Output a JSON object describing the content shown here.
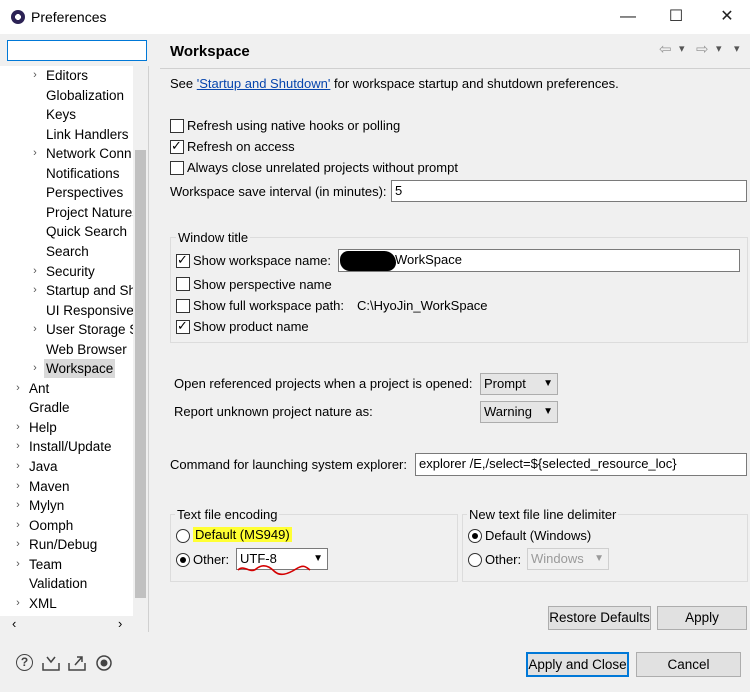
{
  "window": {
    "title": "Preferences"
  },
  "titlebar": {
    "minimize": "—",
    "maximize": "☐",
    "close": "✕"
  },
  "tree": {
    "items": [
      {
        "label": "Editors",
        "level": 2,
        "arrow": "›"
      },
      {
        "label": "Globalization",
        "level": 2,
        "arrow": ""
      },
      {
        "label": "Keys",
        "level": 2,
        "arrow": ""
      },
      {
        "label": "Link Handlers",
        "level": 2,
        "arrow": ""
      },
      {
        "label": "Network Conn",
        "level": 2,
        "arrow": "›"
      },
      {
        "label": "Notifications",
        "level": 2,
        "arrow": ""
      },
      {
        "label": "Perspectives",
        "level": 2,
        "arrow": ""
      },
      {
        "label": "Project Natures",
        "level": 2,
        "arrow": ""
      },
      {
        "label": "Quick Search",
        "level": 2,
        "arrow": ""
      },
      {
        "label": "Search",
        "level": 2,
        "arrow": ""
      },
      {
        "label": "Security",
        "level": 2,
        "arrow": "›"
      },
      {
        "label": "Startup and Sh",
        "level": 2,
        "arrow": "›"
      },
      {
        "label": "UI Responsiver",
        "level": 2,
        "arrow": ""
      },
      {
        "label": "User Storage S",
        "level": 2,
        "arrow": "›"
      },
      {
        "label": "Web Browser",
        "level": 2,
        "arrow": ""
      },
      {
        "label": "Workspace",
        "level": 2,
        "arrow": "›",
        "selected": true
      },
      {
        "label": "Ant",
        "level": 1,
        "arrow": "›"
      },
      {
        "label": "Gradle",
        "level": 1,
        "arrow": ""
      },
      {
        "label": "Help",
        "level": 1,
        "arrow": "›"
      },
      {
        "label": "Install/Update",
        "level": 1,
        "arrow": "›"
      },
      {
        "label": "Java",
        "level": 1,
        "arrow": "›"
      },
      {
        "label": "Maven",
        "level": 1,
        "arrow": "›"
      },
      {
        "label": "Mylyn",
        "level": 1,
        "arrow": "›"
      },
      {
        "label": "Oomph",
        "level": 1,
        "arrow": "›"
      },
      {
        "label": "Run/Debug",
        "level": 1,
        "arrow": "›"
      },
      {
        "label": "Team",
        "level": 1,
        "arrow": "›"
      },
      {
        "label": "Validation",
        "level": 1,
        "arrow": ""
      },
      {
        "label": "XML",
        "level": 1,
        "arrow": "›"
      }
    ],
    "scroll_left": "‹",
    "scroll_right": "›"
  },
  "page": {
    "title": "Workspace",
    "nav_back": "⇦",
    "nav_fwd": "⇨",
    "nav_menu": "▾",
    "intro_prefix": "See ",
    "intro_link": "'Startup and Shutdown'",
    "intro_suffix": " for workspace startup and shutdown preferences.",
    "refresh_native": "Refresh using native hooks or polling",
    "refresh_access": "Refresh on access",
    "always_close": "Always close unrelated projects without prompt",
    "save_interval_label": "Workspace save interval (in minutes):",
    "save_interval_value": "5",
    "window_title_group": "Window title",
    "show_ws_name": "Show workspace name:",
    "ws_name_value": "WorkSpace",
    "show_perspective": "Show perspective name",
    "show_full_path": "Show full workspace path:",
    "full_path_value": "C:\\HyoJin_WorkSpace",
    "show_product": "Show product name",
    "open_ref_label": "Open referenced projects when a project is opened:",
    "open_ref_value": "Prompt",
    "report_unknown_label": "Report unknown project nature as:",
    "report_unknown_value": "Warning",
    "cmd_label": "Command for launching system explorer:",
    "cmd_value": "explorer /E,/select=${selected_resource_loc}",
    "encoding_group": "Text file encoding",
    "enc_default": "Default (MS949)",
    "enc_other": "Other:",
    "enc_other_value": "UTF-8",
    "delim_group": "New text file line delimiter",
    "delim_default": "Default (Windows)",
    "delim_other": "Other:",
    "delim_other_value": "Windows",
    "restore_defaults": "Restore Defaults",
    "apply": "Apply"
  },
  "footer": {
    "apply_close": "Apply and Close",
    "cancel": "Cancel"
  },
  "colors": {
    "highlight": "#ffff33",
    "accent": "#0078d7",
    "annotation": "#d40000"
  }
}
